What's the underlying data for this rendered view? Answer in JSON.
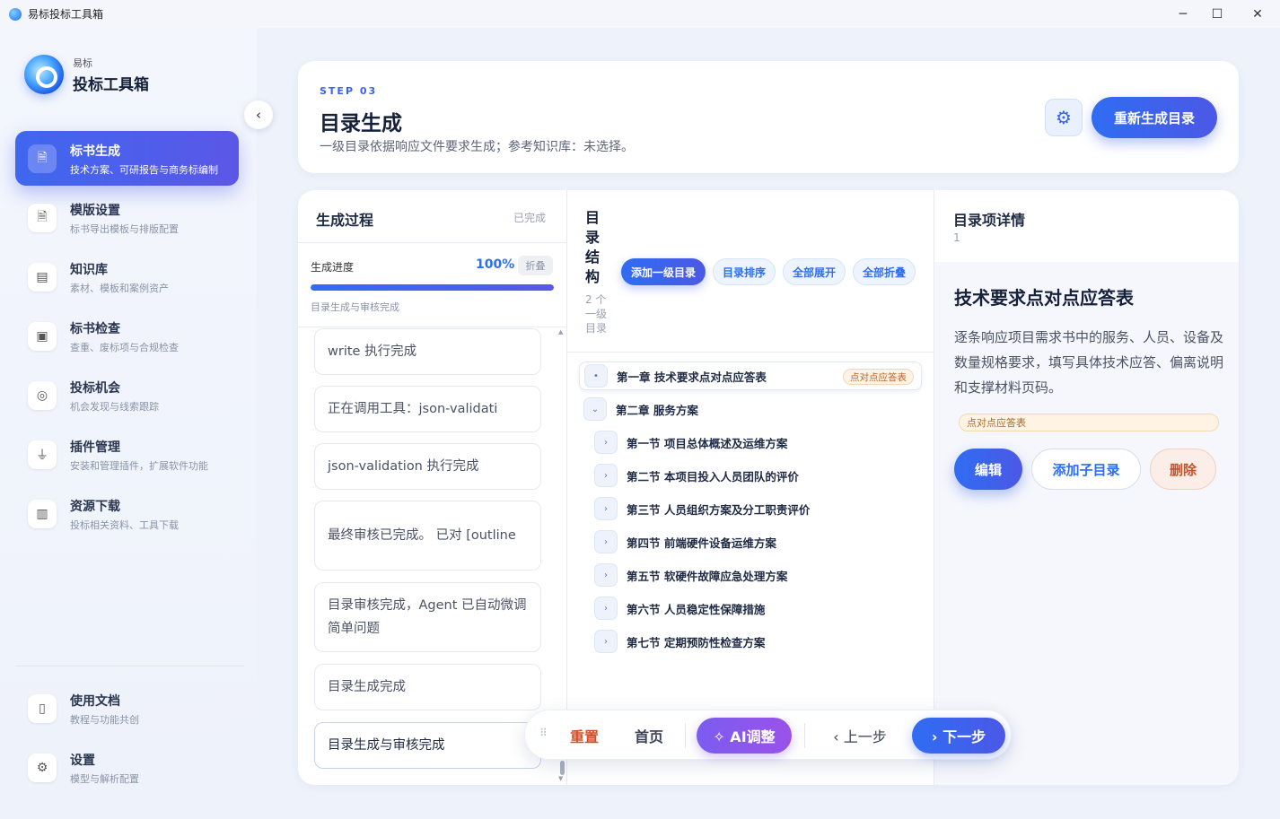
{
  "window": {
    "title": "易标投标工具箱",
    "minimize": "─",
    "maximize": "☐",
    "close": "✕"
  },
  "brand": {
    "small": "易标",
    "title": "投标工具箱"
  },
  "sidebar": {
    "collapse_icon": "‹",
    "items": [
      {
        "label": "标书生成",
        "sub": "技术方案、可研报告与商务标编制",
        "icon": "document-icon",
        "glyph": "🗎"
      },
      {
        "label": "模版设置",
        "sub": "标书导出模板与排版配置",
        "icon": "template-icon",
        "glyph": "🗎"
      },
      {
        "label": "知识库",
        "sub": "素材、模板和案例资产",
        "icon": "archive-icon",
        "glyph": "▤"
      },
      {
        "label": "标书检查",
        "sub": "查重、废标项与合规检查",
        "icon": "check-icon",
        "glyph": "▣"
      },
      {
        "label": "投标机会",
        "sub": "机会发现与线索跟踪",
        "icon": "target-icon",
        "glyph": "◎"
      },
      {
        "label": "插件管理",
        "sub": "安装和管理插件，扩展软件功能",
        "icon": "plug-icon",
        "glyph": "⏚"
      },
      {
        "label": "资源下载",
        "sub": "投标相关资料、工具下载",
        "icon": "books-icon",
        "glyph": "▥"
      }
    ],
    "bottom_items": [
      {
        "label": "使用文档",
        "sub": "教程与功能共创",
        "icon": "book-icon",
        "glyph": "▯"
      },
      {
        "label": "设置",
        "sub": "模型与解析配置",
        "icon": "gear-icon",
        "glyph": "⚙"
      }
    ]
  },
  "header": {
    "step": "STEP 03",
    "title": "目录生成",
    "desc": "一级目录依据响应文件要求生成；参考知识库：未选择。",
    "settings_icon": "⚙",
    "regen_label": "重新生成目录"
  },
  "process": {
    "title": "生成过程",
    "status": "已完成",
    "progress_label": "生成进度",
    "progress_pct": "100%",
    "progress_value": 1.0,
    "fold_label": "折叠",
    "progress_sub": "目录生成与审核完成",
    "logs": [
      "write 执行完成",
      "正在调用工具：json-validati",
      "json-validation 执行完成",
      "最终审核已完成。 已对 [outline",
      "目录审核完成，Agent 已自动微调简单问题",
      "目录生成完成",
      "目录生成与审核完成"
    ]
  },
  "toc": {
    "title": "目录结构",
    "count": "2 个一级目录",
    "actions": {
      "add_root": "添加一级目录",
      "sort": "目录排序",
      "expand_all": "全部展开",
      "collapse_all": "全部折叠"
    },
    "rows": [
      {
        "text": "第一章 技术要求点对点应答表",
        "tag": "点对点应答表",
        "chev": "•",
        "level": 0
      },
      {
        "text": "第二章 服务方案",
        "chev": "⌄",
        "level": 0
      },
      {
        "text": "第一节 项目总体概述及运维方案",
        "chev": "›",
        "level": 1
      },
      {
        "text": "第二节 本项目投入人员团队的评价",
        "chev": "›",
        "level": 1
      },
      {
        "text": "第三节 人员组织方案及分工职责评价",
        "chev": "›",
        "level": 1
      },
      {
        "text": "第四节 前端硬件设备运维方案",
        "chev": "›",
        "level": 1
      },
      {
        "text": "第五节 软硬件故障应急处理方案",
        "chev": "›",
        "level": 1
      },
      {
        "text": "第六节 人员稳定性保障措施",
        "chev": "›",
        "level": 1
      },
      {
        "text": "第七节 定期预防性检查方案",
        "chev": "›",
        "level": 1
      }
    ]
  },
  "detail": {
    "title": "目录项详情",
    "num": "1",
    "item_title": "技术要求点对点应答表",
    "item_desc": "逐条响应项目需求书中的服务、人员、设备及数量规格要求，填写具体技术应答、偏离说明和支撑材料页码。",
    "item_tag": "点对点应答表",
    "edit": "编辑",
    "add_child": "添加子目录",
    "delete": "删除"
  },
  "bottom_bar": {
    "drag_icon": "⠿",
    "reset": "重置",
    "home": "首页",
    "ai": "✧ AI调整",
    "prev": "‹  上一步",
    "next": "›  下一步"
  }
}
